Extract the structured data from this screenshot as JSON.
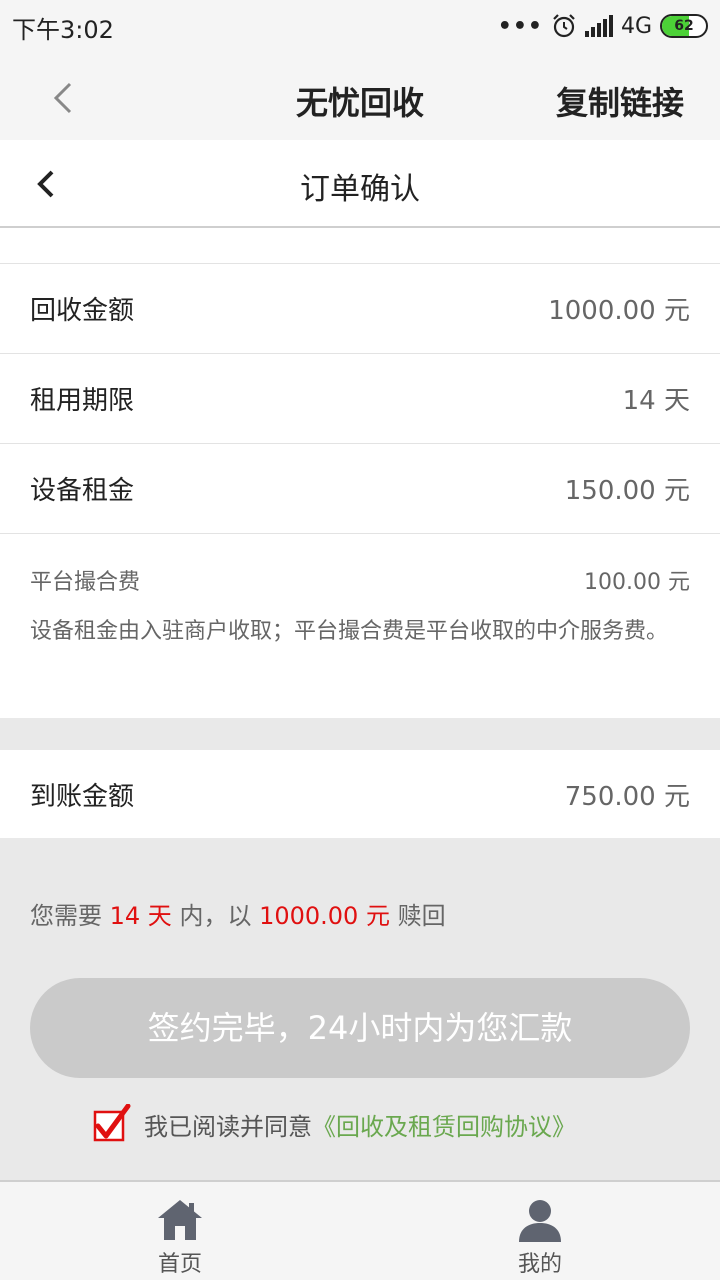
{
  "status_bar": {
    "time": "下午3:02",
    "network": "4G",
    "battery": "62",
    "battery_level": 0.62
  },
  "app_bar": {
    "title": "无忧回收",
    "action_label": "复制链接"
  },
  "page_header": {
    "title": "订单确认"
  },
  "order_rows": [
    {
      "label": "回收金额",
      "value": "1000.00 元"
    },
    {
      "label": "租用期限",
      "value": "14 天"
    },
    {
      "label": "设备租金",
      "value": "150.00 元"
    }
  ],
  "platform_fee": {
    "label": "平台撮合费",
    "value": "100.00 元",
    "note": "设备租金由入驻商户收取；平台撮合费是平台收取的中介服务费。"
  },
  "settlement": {
    "label": "到账金额",
    "value": "750.00 元"
  },
  "redeem_notice": {
    "prefix": "您需要 ",
    "days": "14 天",
    "middle": " 内，以 ",
    "amount": "1000.00 元",
    "suffix": " 赎回"
  },
  "submit_button": {
    "label": "签约完毕，24小时内为您汇款"
  },
  "agreement": {
    "checked": true,
    "text": "我已阅读并同意",
    "link": "《回收及租赁回购协议》"
  },
  "tabs": [
    {
      "label": "首页",
      "icon": "home-icon"
    },
    {
      "label": "我的",
      "icon": "user-icon"
    }
  ],
  "colors": {
    "accent_red": "#e01010",
    "link_green": "#6aa84f",
    "button_disabled": "#cacaca"
  }
}
